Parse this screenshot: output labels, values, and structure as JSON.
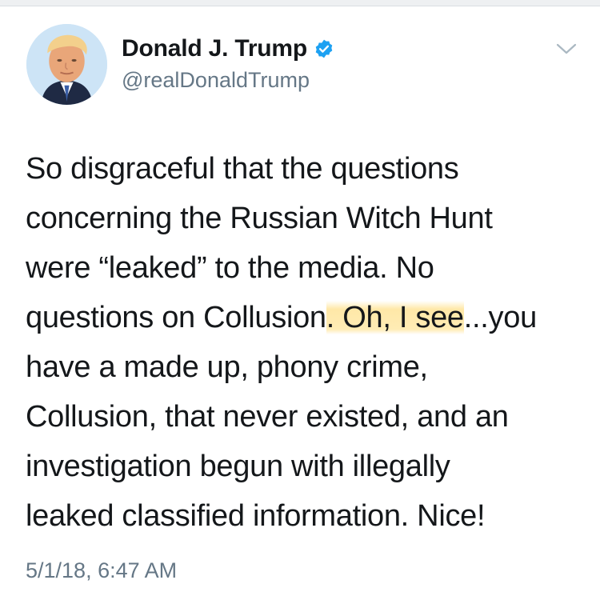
{
  "author": {
    "display_name": "Donald J. Trump",
    "handle": "@realDonaldTrump",
    "verified": true,
    "verified_icon": "verified-badge-icon",
    "avatar": "profile-photo"
  },
  "menu_icon": "chevron-down-icon",
  "tweet": {
    "lines": [
      "So disgraceful that the questions",
      "concerning the Russian Witch Hunt",
      "were “leaked” to the media. No"
    ],
    "line4_before": "questions on Collusion",
    "line4_highlight": ". Oh, I see",
    "line4_after": "...you",
    "lines_rest": [
      "have a made up, phony crime,",
      "Collusion, that never existed, and an",
      "investigation begun with illegally",
      "leaked classified information. Nice!"
    ]
  },
  "timestamp": "5/1/18, 6:47 AM",
  "colors": {
    "text": "#14171a",
    "secondary": "#657786",
    "verified_blue": "#1da1f2",
    "highlight": "#ffdc78"
  }
}
